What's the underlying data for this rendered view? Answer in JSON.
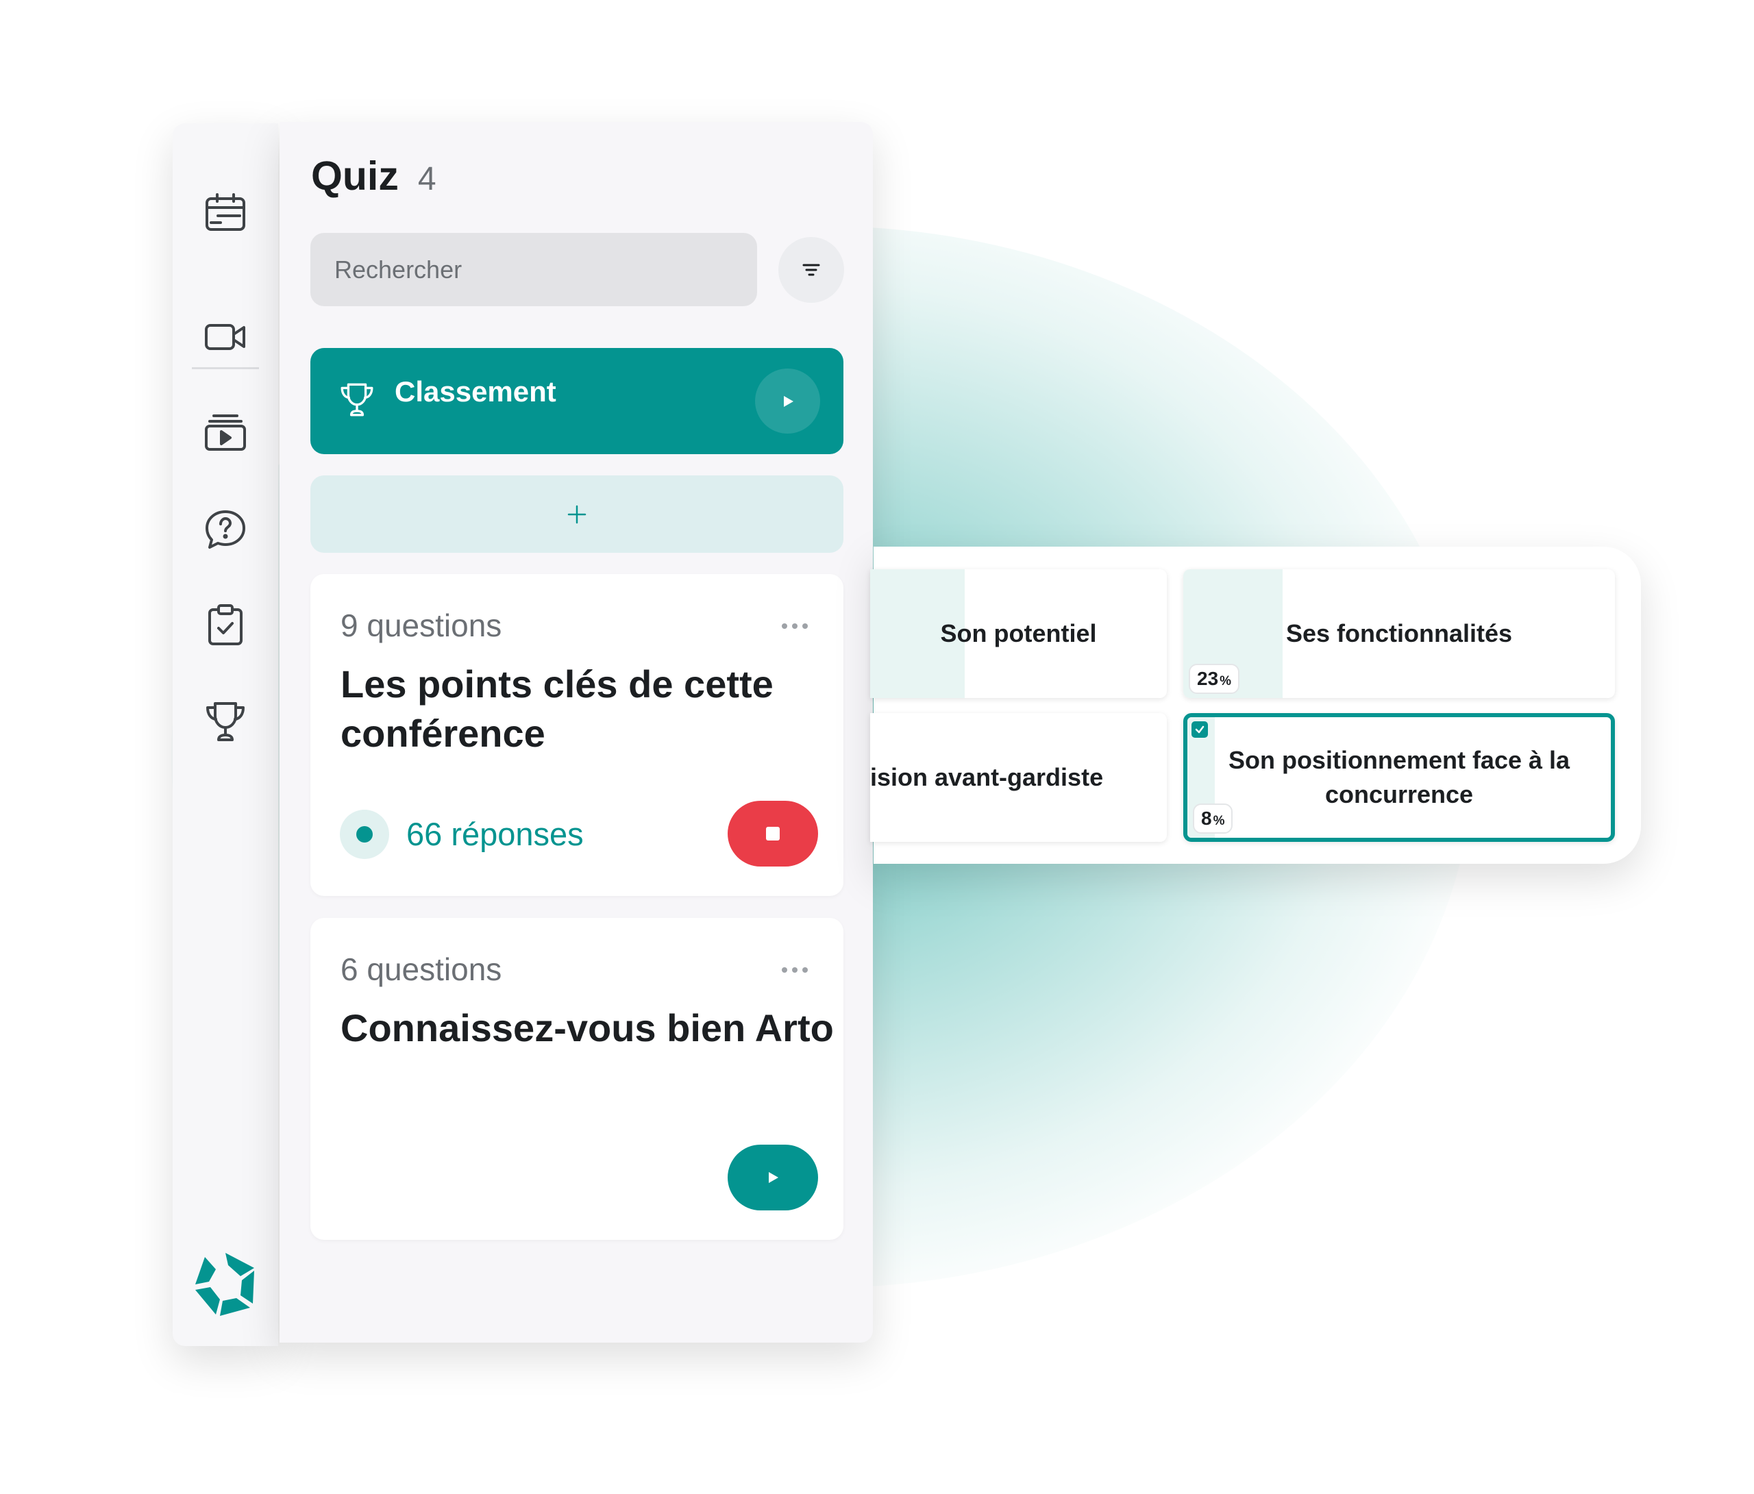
{
  "colors": {
    "accent": "#049490",
    "danger": "#ea3d48",
    "accent_light": "#ddeeef",
    "text": "#1c1f22",
    "muted": "#6b6f74"
  },
  "sidebar": {
    "items": [
      {
        "icon": "calendar-icon"
      },
      {
        "icon": "video-camera-icon"
      },
      {
        "icon": "media-play-icon"
      },
      {
        "icon": "question-bubble-icon"
      },
      {
        "icon": "clipboard-check-icon"
      },
      {
        "icon": "trophy-icon"
      }
    ],
    "logo": "app-logo"
  },
  "panel": {
    "title": "Quiz",
    "count": "4",
    "search": {
      "placeholder": "Rechercher"
    },
    "filter_icon": "filter-icon",
    "classement": {
      "label": "Classement"
    },
    "add_label": "+"
  },
  "quizzes": [
    {
      "questions": "9 questions",
      "title_lines": [
        "Les points clés de cette",
        "conférence"
      ],
      "responses": "66 réponses",
      "state": "running"
    },
    {
      "questions": "6 questions",
      "title_lines": [
        "Connaissez-vous bien Arto"
      ],
      "state": "stopped"
    }
  ],
  "answers": [
    {
      "text": "Son potentiel",
      "percent": null,
      "bar_fraction": 0.22
    },
    {
      "text": "Ses fonctionnalités",
      "percent": "23",
      "bar_fraction": 0.23
    },
    {
      "text": "ision avant-gardiste",
      "percent": null,
      "bar_fraction": 0
    },
    {
      "text": "Son positionnement face à la concurrence",
      "percent": "8",
      "bar_fraction": 0.08,
      "selected": true
    }
  ],
  "percent_sign": "%"
}
